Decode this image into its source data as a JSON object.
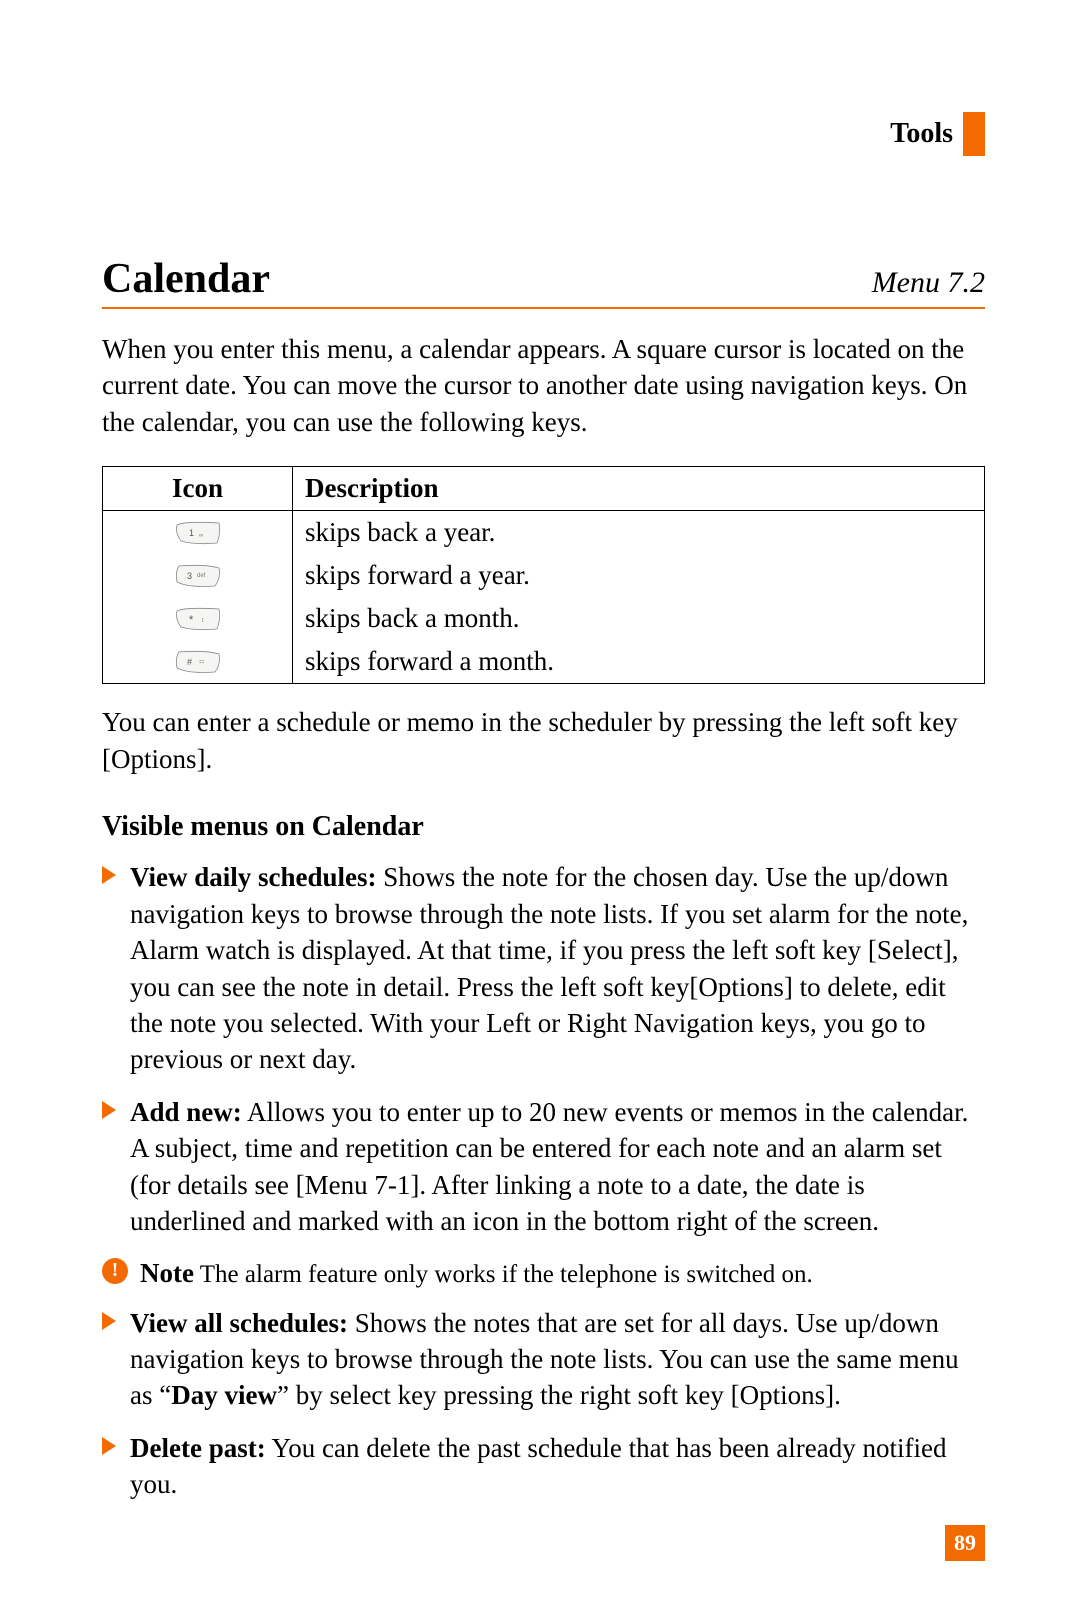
{
  "header": {
    "section_label": "Tools"
  },
  "title": "Calendar",
  "menu_number": "Menu 7.2",
  "intro": "When you enter this menu, a calendar appears. A square cursor is located on the current date. You can move the cursor to another date using navigation keys. On the calendar, you can use the following keys.",
  "table": {
    "headers": [
      "Icon",
      "Description"
    ],
    "rows": [
      {
        "icon": "key-1",
        "desc": "skips back a year."
      },
      {
        "icon": "key-3-def",
        "desc": "skips forward a year."
      },
      {
        "icon": "key-star",
        "desc": "skips back a month."
      },
      {
        "icon": "key-hash",
        "desc": "skips forward a month."
      }
    ]
  },
  "after_table": "You can enter a schedule or memo in the scheduler by pressing the left soft key [Options].",
  "subheading": "Visible menus on Calendar",
  "items": [
    {
      "title": "View daily schedules:",
      "body": " Shows the note for the chosen day. Use the up/down navigation keys to browse through the note lists. If you set alarm for the note, Alarm watch is displayed. At that time, if you press the left soft key [Select], you can see the note in detail. Press the left soft key[Options] to delete, edit the note you selected. With your Left or Right Navigation keys, you go to previous or next day."
    },
    {
      "title": "Add new:",
      "body": " Allows you to enter up to 20 new events or memos in the calendar. A subject, time and repetition can be entered for each note and an alarm set  (for details see [Menu 7-1]. After linking a note to a date, the date is underlined and marked with an icon in the bottom right of the screen."
    }
  ],
  "note": {
    "label": "Note",
    "text": "  The alarm feature only works if the telephone is switched on."
  },
  "items2": [
    {
      "title": "View all schedules:",
      "body_pre": " Shows the notes that are set for all days. Use up/down navigation keys to browse through the note lists. You can use the same menu as “",
      "body_bold": "Day view",
      "body_post": "” by select key pressing the right soft key [Options]."
    },
    {
      "title": "Delete past:",
      "body": " You can delete the past schedule that has been already notified you."
    }
  ],
  "page_number": "89"
}
